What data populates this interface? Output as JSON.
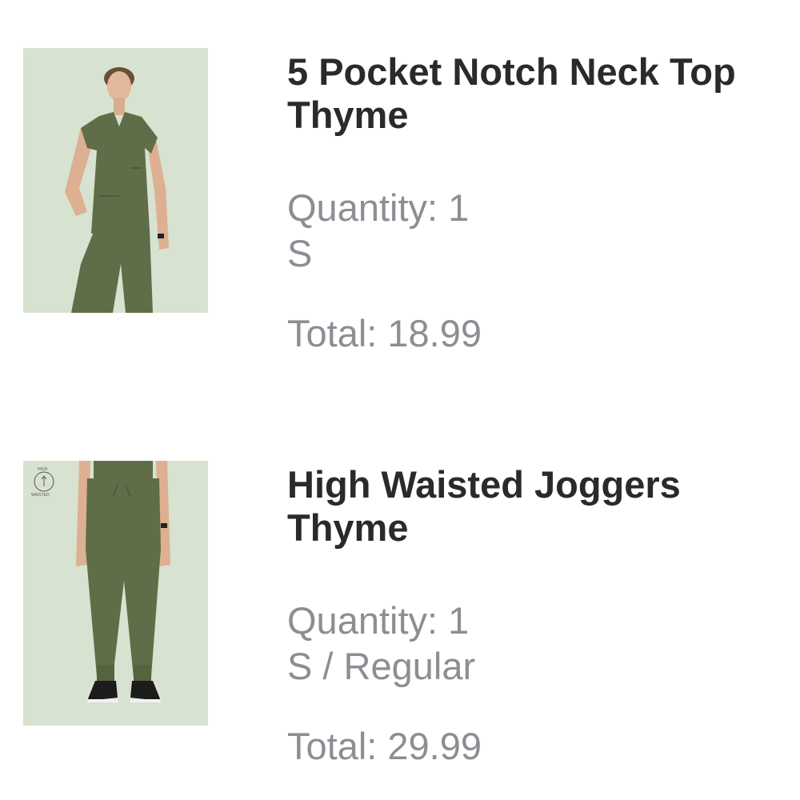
{
  "order_items": [
    {
      "image_icon": "scrub-top-photo",
      "title_line1": "5 Pocket Notch Neck Top",
      "title_line2": "Thyme",
      "quantity_text": "Quantity: 1",
      "variant_text": "S",
      "total_text": "Total: 18.99"
    },
    {
      "image_icon": "joggers-photo",
      "badge_text_top": "HIGH",
      "badge_text_bottom": "WAISTED",
      "title_line1": "High Waisted Joggers",
      "title_line2": "Thyme",
      "quantity_text": "Quantity: 1",
      "variant_text": "S / Regular",
      "total_text": "Total: 29.99"
    }
  ],
  "colors": {
    "thumb_background": "#d8e2d0",
    "garment": "#5f6e48",
    "title_text": "#2a2a2a",
    "meta_text": "#8b8e93"
  }
}
